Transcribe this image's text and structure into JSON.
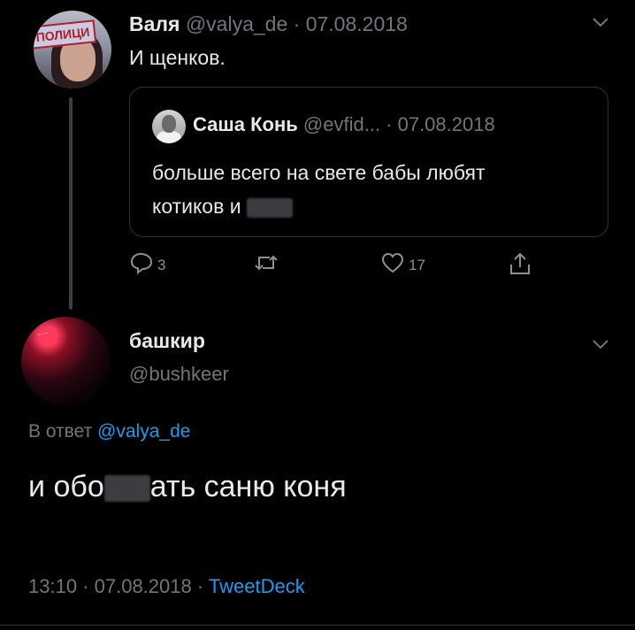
{
  "tweet": {
    "author_name": "Валя",
    "author_handle": "@valya_de",
    "date": "07.08.2018",
    "text": "И щенков.",
    "avatar_sign": "ПОЛИЦИ",
    "quote": {
      "author_name": "Саша Конь",
      "author_handle": "@evfid...",
      "date": "07.08.2018",
      "text_line1": "больше всего на свете бабы любят",
      "text_line2": "котиков и"
    },
    "actions": {
      "reply_count": "3",
      "like_count": "17"
    }
  },
  "reply": {
    "author_name": "башкир",
    "author_handle": "@bushkeer",
    "reply_label": "В ответ",
    "reply_to": "@valya_de",
    "text_part1": "и обо",
    "text_part2": "ать саню коня",
    "time": "13:10",
    "date": "07.08.2018",
    "source": "TweetDeck"
  },
  "colors": {
    "background": "#000000",
    "text": "#e7e9ea",
    "muted": "#71767b",
    "link": "#1d9bf0"
  }
}
